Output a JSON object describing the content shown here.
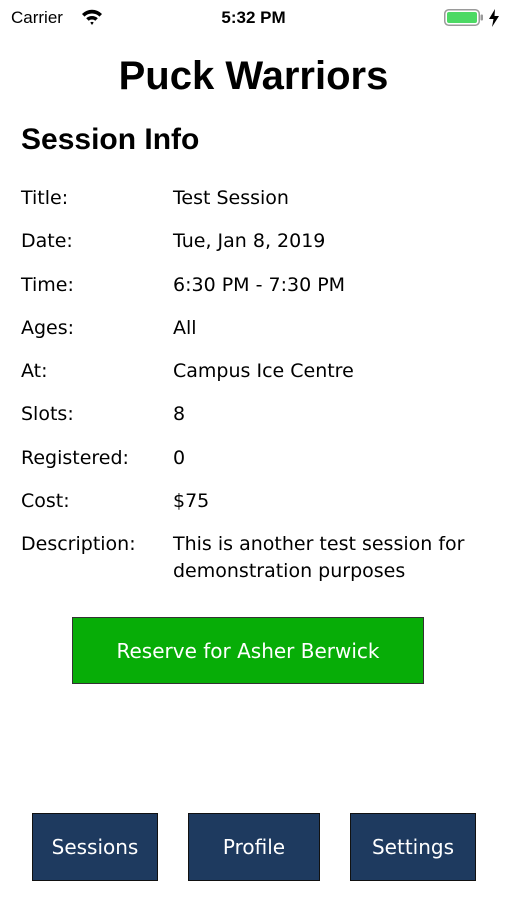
{
  "status_bar": {
    "carrier": "Carrier",
    "time": "5:32 PM",
    "battery_color": "#4cd964"
  },
  "header": {
    "app_title": "Puck Warriors",
    "section_title": "Session Info"
  },
  "session": {
    "rows": [
      {
        "label": "Title:",
        "value": "Test Session"
      },
      {
        "label": "Date:",
        "value": "Tue, Jan 8, 2019"
      },
      {
        "label": "Time:",
        "value": "6:30 PM - 7:30 PM"
      },
      {
        "label": "Ages:",
        "value": "All"
      },
      {
        "label": "At:",
        "value": "Campus Ice Centre"
      },
      {
        "label": "Slots:",
        "value": "8"
      },
      {
        "label": "Registered:",
        "value": "0"
      },
      {
        "label": "Cost:",
        "value": "$75"
      },
      {
        "label": "Description:",
        "value": "This is another test session for demonstration purposes"
      }
    ]
  },
  "reserve": {
    "label": "Reserve for Asher Berwick",
    "color": "#07ad07"
  },
  "nav": {
    "color": "#1e3a5f",
    "sessions_label": "Sessions",
    "profile_label": "Profile",
    "settings_label": "Settings"
  }
}
